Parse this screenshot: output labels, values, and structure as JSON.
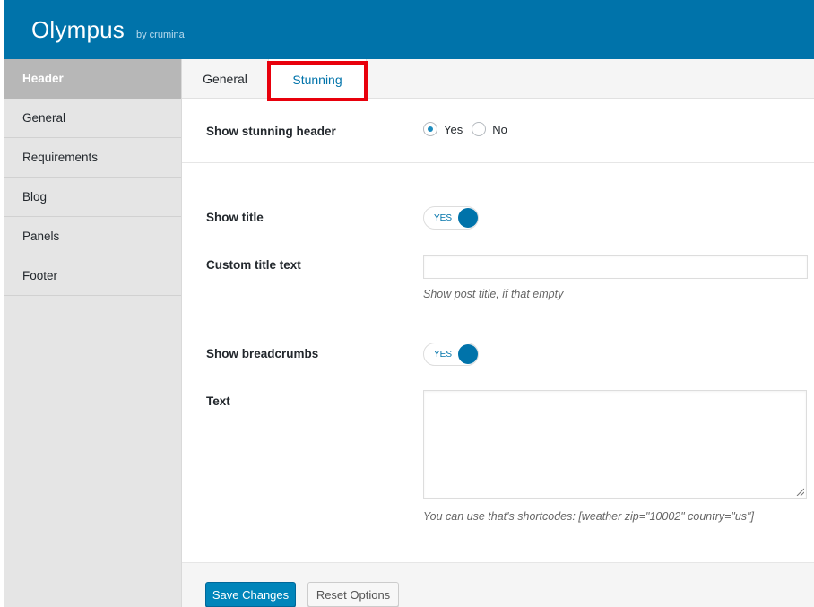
{
  "app": {
    "title": "Olympus",
    "byline": "by crumina"
  },
  "sidebar": {
    "items": [
      {
        "label": "Header",
        "active": true
      },
      {
        "label": "General"
      },
      {
        "label": "Requirements"
      },
      {
        "label": "Blog"
      },
      {
        "label": "Panels"
      },
      {
        "label": "Footer"
      }
    ]
  },
  "tabs": {
    "general": "General",
    "stunning": "Stunning"
  },
  "fields": {
    "show_stunning_header": {
      "label": "Show stunning header",
      "options": [
        "Yes",
        "No"
      ],
      "selected": "Yes"
    },
    "show_title": {
      "label": "Show title",
      "toggle": "YES"
    },
    "custom_title_text": {
      "label": "Custom title text",
      "value": "",
      "hint": "Show post title, if that empty"
    },
    "show_breadcrumbs": {
      "label": "Show breadcrumbs",
      "toggle": "YES"
    },
    "text": {
      "label": "Text",
      "value": "",
      "hint": "You can use that's shortcodes: [weather zip=\"10002\" country=\"us\"]"
    }
  },
  "actions": {
    "save": "Save Changes",
    "reset": "Reset Options"
  },
  "colors": {
    "accent": "#0073aa",
    "sidebar_active": "#b7b7b7",
    "highlight": "#e8000c"
  }
}
